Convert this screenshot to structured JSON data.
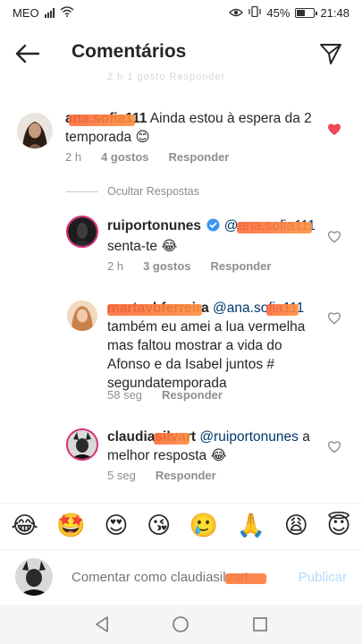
{
  "status": {
    "carrier": "MEO",
    "battery": "45%",
    "battery_level": 0.45,
    "time": "21:48"
  },
  "header": {
    "title": "Comentários"
  },
  "ghost": {
    "text": "2 h    1 gosto    Responder"
  },
  "comments": [
    {
      "username": "ana.sofia111",
      "text": "Ainda estou à espera da 2 temporada 😊",
      "time": "2 h",
      "likes": "4 gostos",
      "reply": "Responder",
      "liked": true
    },
    {
      "username": "ruiportonunes",
      "mention": "@ana.sofia111",
      "text": "senta-te 😂",
      "time": "2 h",
      "likes": "3 gostos",
      "reply": "Responder",
      "verified": true
    },
    {
      "username": "martavbferreira",
      "mention": "@ana.sofia111",
      "text": "também eu  amei a lua vermelha mas faltou mostrar a vida do Afonso e da Isabel juntos # segundatemporada",
      "time": "58 seg",
      "reply": "Responder"
    },
    {
      "username": "claudiasilvart",
      "mention": "@ruiportonunes",
      "text": "a melhor resposta 😂",
      "time": "5 seg",
      "reply": "Responder"
    }
  ],
  "hide_replies": "Ocultar Respostas",
  "emojis": [
    "😂",
    "🤩",
    "😍",
    "😘",
    "🥲",
    "🙏",
    "😩",
    "😇"
  ],
  "composer": {
    "placeholder": "Comentar como claudiasilvart...",
    "publish": "Publicar"
  },
  "colors": {
    "heart": "#ed4956",
    "link": "#00376b",
    "muted": "#8e8e8e",
    "publish": "#b3dbff",
    "verified": "#3897f0",
    "redaction": "#ff7a3d"
  }
}
